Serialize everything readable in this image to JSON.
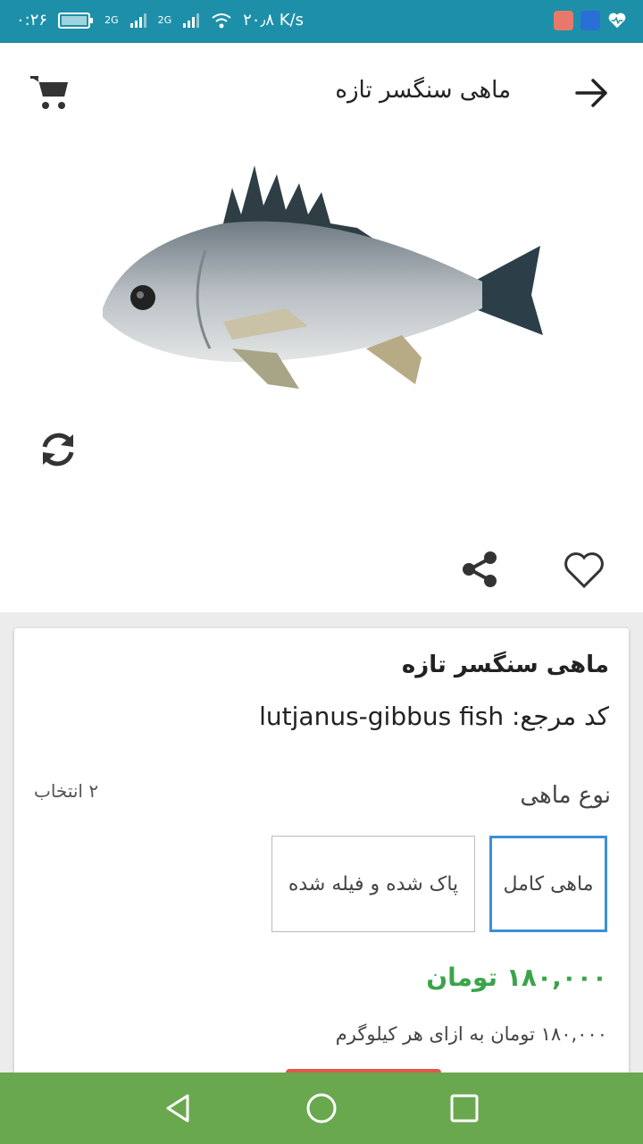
{
  "status_bar": {
    "time": "۰:۲۶",
    "network_speed": "۲۰٫۸ K/s",
    "signal_1": "2G",
    "signal_2": "2G"
  },
  "app_bar": {
    "title": "ماهی سنگسر تازه",
    "icons": [
      "arrow-right-icon",
      "cart-icon"
    ]
  },
  "gallery": {
    "image": "grunt-fish-image",
    "actions": [
      "refresh-icon",
      "share-icon",
      "heart-icon"
    ]
  },
  "product": {
    "name": "ماهی سنگسر تازه",
    "reference": "کد مرجع: lutjanus-gibbus fish",
    "option_group_label": "نوع ماهی",
    "option_count": "۲ انتخاب",
    "options": [
      {
        "label": "ماهی کامل",
        "selected": true
      },
      {
        "label": "پاک شده و فیله شده",
        "selected": false
      }
    ],
    "price": "۱۸۰,۰۰۰ تومان",
    "unit_price_note": "۱۸۰,۰۰۰ تومان به ازای هر کیلوگرم"
  },
  "colors": {
    "status_bar": "#1e8fa8",
    "nav_bar": "#6aa84f",
    "price": "#3aa44a",
    "selected_border": "#3d8fd6",
    "buy_button": "#e0584a"
  },
  "nav_bar": {
    "icons": [
      "back-triangle-icon",
      "home-circle-icon",
      "recents-square-icon"
    ]
  }
}
